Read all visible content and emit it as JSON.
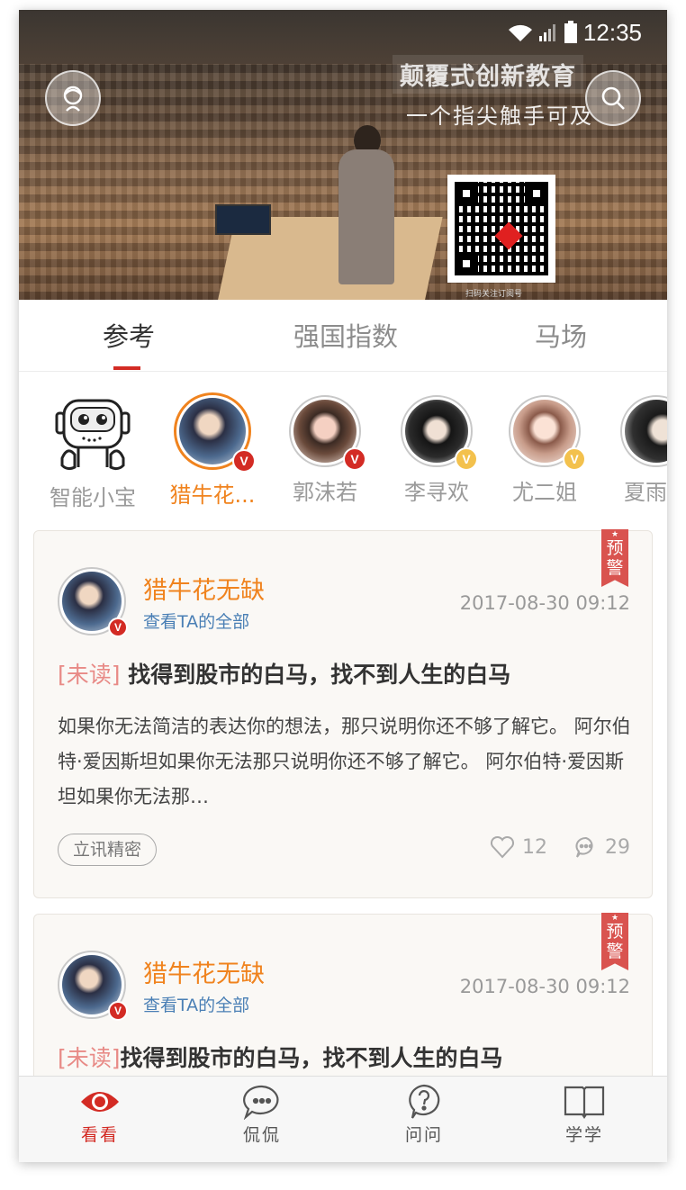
{
  "status_bar": {
    "time": "12:35"
  },
  "hero": {
    "title": "颠覆式创新教育",
    "subtitle": "一个指尖触手可及",
    "qr_caption": "扫码关注订阅号"
  },
  "tabs": [
    {
      "label": "参考",
      "active": true
    },
    {
      "label": "强国指数",
      "active": false
    },
    {
      "label": "马场",
      "active": false
    }
  ],
  "people": [
    {
      "name": "智能小宝",
      "avatar": "robot-icon",
      "badge": ""
    },
    {
      "name": "猎牛花...",
      "avatar": "photo",
      "badge": "V",
      "badge_color": "#d32b24",
      "selected": true
    },
    {
      "name": "郭沫若",
      "avatar": "photo",
      "badge": "V",
      "badge_color": "#d32b24"
    },
    {
      "name": "李寻欢",
      "avatar": "photo",
      "badge": "V",
      "badge_color": "#f3c14d"
    },
    {
      "name": "尤二姐",
      "avatar": "photo",
      "badge": "V",
      "badge_color": "#f3c14d"
    },
    {
      "name": "夏雨",
      "avatar": "photo",
      "badge": ""
    }
  ],
  "cards": [
    {
      "ribbon": "预警",
      "author": "猎牛花无缺",
      "view_all": "查看TA的全部",
      "time": "2017-08-30 09:12",
      "unread": "[未读]",
      "title": "找得到股市的白马，找不到人生的白马",
      "body": "如果你无法简洁的表达你的想法，那只说明你还不够了解它。 阿尔伯特·爱因斯坦如果你无法那只说明你还不够了解它。 阿尔伯特·爱因斯坦如果你无法那…",
      "tag": "立讯精密",
      "likes": "12",
      "comments": "29"
    },
    {
      "ribbon": "预警",
      "author": "猎牛花无缺",
      "view_all": "查看TA的全部",
      "time": "2017-08-30 09:12",
      "unread": "[未读]",
      "title": "找得到股市的白马，找不到人生的白马"
    }
  ],
  "bottom_nav": [
    {
      "label": "看看",
      "icon": "eye-icon",
      "active": true
    },
    {
      "label": "侃侃",
      "icon": "chat-bubble-icon",
      "active": false
    },
    {
      "label": "问问",
      "icon": "question-icon",
      "active": false
    },
    {
      "label": "学学",
      "icon": "book-icon",
      "active": false
    }
  ],
  "colors": {
    "accent": "#d32b24",
    "orange": "#f0831e",
    "link": "#4a7fb5"
  }
}
